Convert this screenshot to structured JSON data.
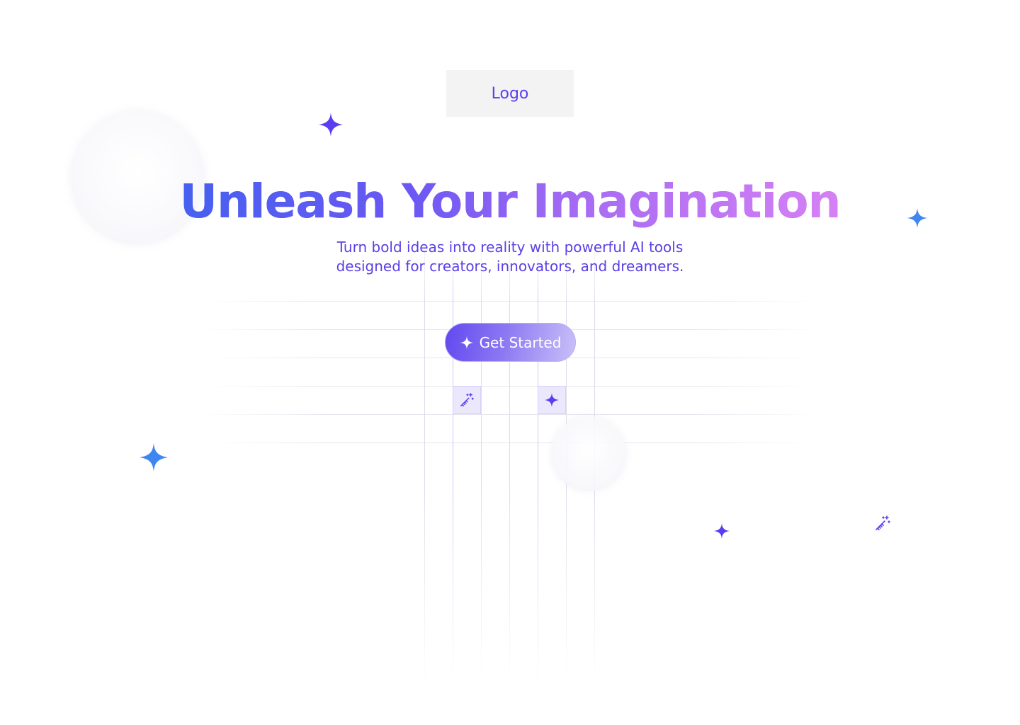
{
  "header": {
    "logo_label": "Logo"
  },
  "hero": {
    "title": "Unleash Your Imagination",
    "subtitle": "Turn bold ideas into reality with powerful AI tools designed for creators, innovators, and dreamers.",
    "cta_label": "Get Started"
  },
  "icons": {
    "cta": "sparkle-icon",
    "tile_left": "magic-wand-icon",
    "tile_right": "sparkle-icon",
    "floating": [
      "sparkle-icon",
      "sparkle-icon",
      "sparkle-icon",
      "sparkle-icon",
      "magic-wand-icon"
    ]
  },
  "colors": {
    "accent": "#5b3df0",
    "gradient_start": "#4660f0",
    "gradient_end": "#d680f4",
    "sparkle_blue": "#3f86f0",
    "sparkle_purple": "#5b3df0",
    "tile_bg": "#ebe7fd",
    "logo_bg": "#f3f3f4"
  }
}
